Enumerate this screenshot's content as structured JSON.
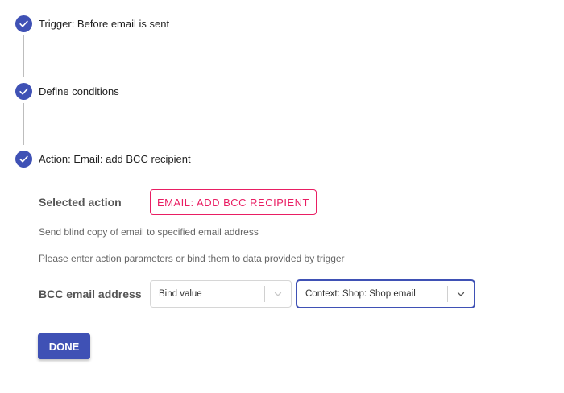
{
  "steps": [
    {
      "label": "Trigger: Before email is sent",
      "status": "completed",
      "icon": "check-icon"
    },
    {
      "label": "Define conditions",
      "status": "completed",
      "icon": "check-icon"
    },
    {
      "label": "Action: Email: add BCC recipient",
      "status": "completed",
      "icon": "check-icon"
    }
  ],
  "action": {
    "selected_label": "Selected action",
    "chip_text": "EMAIL: ADD BCC RECIPIENT",
    "description": "Send blind copy of email to specified email address",
    "instructions": "Please enter action parameters or bind them to data provided by trigger"
  },
  "params": {
    "bcc_label": "BCC email address",
    "mode_select": {
      "value": "Bind value",
      "icon": "chevron-down-icon"
    },
    "context_select": {
      "value": "Context: Shop: Shop email",
      "icon": "chevron-down-icon",
      "focused": true
    }
  },
  "done_label": "DONE",
  "colors": {
    "primary": "#3f51b5",
    "accent": "#e91e63",
    "muted_text": "#666666",
    "connector": "#bdbdbd"
  }
}
